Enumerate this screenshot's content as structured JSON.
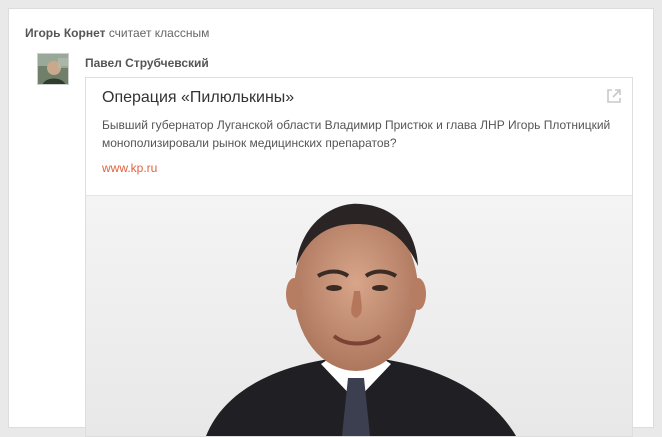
{
  "post": {
    "reactor_name": "Игорь Корнет",
    "reaction_text": "считает классным",
    "author_name": "Павел Струбчевский",
    "link": {
      "title": "Операция «Пилюлькины»",
      "description": "Бывший губернатор Луганской области Владимир Пристюк и глава ЛНР Игорь Плотницкий монополизировали рынок медицинских препаратов?",
      "domain": "www.kp.ru"
    }
  },
  "icons": {
    "external": "external-link-icon"
  },
  "colors": {
    "background": "#e9e9e9",
    "card": "#ffffff",
    "domain_link": "#e2623e",
    "text_muted": "#666666"
  }
}
